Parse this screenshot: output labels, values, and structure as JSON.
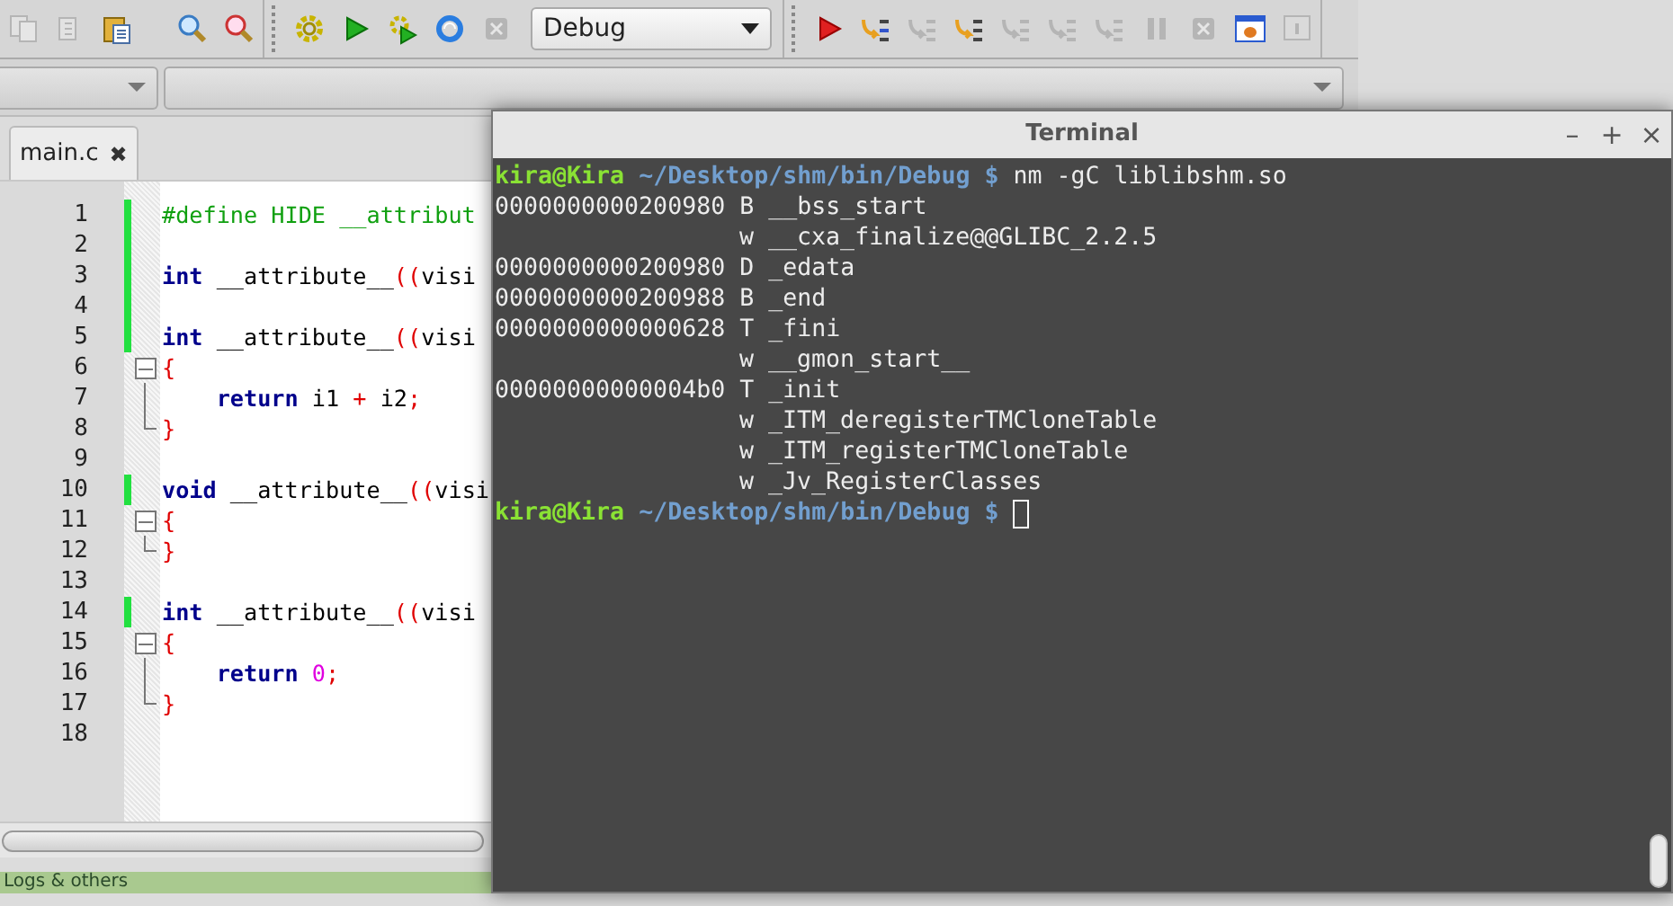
{
  "toolbar": {
    "groups": [
      {
        "buttons": [
          {
            "kind": "copy",
            "disabled": true
          },
          {
            "kind": "paste",
            "disabled": true
          },
          {
            "kind": "clipboard",
            "disabled": false
          },
          {
            "kind": "find",
            "disabled": false
          },
          {
            "kind": "replace",
            "disabled": false
          }
        ]
      },
      {
        "buttons": [
          {
            "kind": "build",
            "disabled": false
          },
          {
            "kind": "run",
            "disabled": false
          },
          {
            "kind": "build-run",
            "disabled": false
          },
          {
            "kind": "rebuild",
            "disabled": false
          },
          {
            "kind": "abort",
            "disabled": true
          }
        ],
        "target": {
          "value": "Debug"
        }
      },
      {
        "buttons": [
          {
            "kind": "debug",
            "disabled": false
          },
          {
            "kind": "step-into",
            "disabled": false
          },
          {
            "kind": "step-out",
            "disabled": true
          },
          {
            "kind": "next-line",
            "disabled": false
          },
          {
            "kind": "step-back",
            "disabled": true
          },
          {
            "kind": "next-instruction",
            "disabled": true
          },
          {
            "kind": "step-instruction",
            "disabled": true
          },
          {
            "kind": "pause",
            "disabled": true
          },
          {
            "kind": "stop",
            "disabled": true
          },
          {
            "kind": "debug-window",
            "disabled": false
          },
          {
            "kind": "info",
            "disabled": true
          }
        ]
      }
    ]
  },
  "tabs": [
    {
      "label": "main.c",
      "close": "✖",
      "selected": true
    }
  ],
  "editor": {
    "lines": [
      {
        "number": "1",
        "changed": true,
        "fold_start": false,
        "fold_end": false,
        "tokens": [
          {
            "kind": "preprocessor",
            "text": "#define HIDE __attribut"
          }
        ]
      },
      {
        "number": "2",
        "changed": true,
        "fold_start": false,
        "fold_end": false
      },
      {
        "number": "3",
        "changed": true,
        "fold_start": false,
        "fold_end": false,
        "tokens": [
          {
            "kind": "keyword",
            "text": "int"
          },
          {
            "kind": "plain",
            "text": " __attribute__"
          },
          {
            "kind": "punct",
            "text": "(("
          },
          {
            "kind": "plain",
            "text": "visi"
          }
        ]
      },
      {
        "number": "4",
        "changed": true,
        "fold_start": false,
        "fold_end": false
      },
      {
        "number": "5",
        "changed": true,
        "fold_start": false,
        "fold_end": false,
        "tokens": [
          {
            "kind": "keyword",
            "text": "int"
          },
          {
            "kind": "plain",
            "text": " __attribute__"
          },
          {
            "kind": "punct",
            "text": "(("
          },
          {
            "kind": "plain",
            "text": "visi"
          }
        ]
      },
      {
        "number": "6",
        "changed": false,
        "fold_start": true,
        "fold_end": false,
        "tokens": [
          {
            "kind": "punct",
            "text": "{"
          }
        ]
      },
      {
        "number": "7",
        "changed": false,
        "fold_start": false,
        "fold_end": false,
        "tokens": [
          {
            "kind": "keyword",
            "text": "    return"
          },
          {
            "kind": "plain",
            "text": " i1 "
          },
          {
            "kind": "punct",
            "text": "+"
          },
          {
            "kind": "plain",
            "text": " i2"
          },
          {
            "kind": "punct",
            "text": ";"
          }
        ]
      },
      {
        "number": "8",
        "changed": false,
        "fold_start": false,
        "fold_end": true,
        "tokens": [
          {
            "kind": "punct",
            "text": "}"
          }
        ]
      },
      {
        "number": "9",
        "changed": false,
        "fold_start": false,
        "fold_end": false
      },
      {
        "number": "10",
        "changed": true,
        "fold_start": false,
        "fold_end": false,
        "tokens": [
          {
            "kind": "keyword",
            "text": "void"
          },
          {
            "kind": "plain",
            "text": " __attribute__"
          },
          {
            "kind": "punct",
            "text": "(("
          },
          {
            "kind": "plain",
            "text": "visi"
          }
        ]
      },
      {
        "number": "11",
        "changed": false,
        "fold_start": true,
        "fold_end": false,
        "tokens": [
          {
            "kind": "punct",
            "text": "{"
          }
        ]
      },
      {
        "number": "12",
        "changed": false,
        "fold_start": false,
        "fold_end": true,
        "tokens": [
          {
            "kind": "punct",
            "text": "}"
          }
        ]
      },
      {
        "number": "13",
        "changed": false,
        "fold_start": false,
        "fold_end": false
      },
      {
        "number": "14",
        "changed": true,
        "fold_start": false,
        "fold_end": false,
        "tokens": [
          {
            "kind": "keyword",
            "text": "int"
          },
          {
            "kind": "plain",
            "text": " __attribute__"
          },
          {
            "kind": "punct",
            "text": "(("
          },
          {
            "kind": "plain",
            "text": "visi"
          }
        ]
      },
      {
        "number": "15",
        "changed": false,
        "fold_start": true,
        "fold_end": false,
        "tokens": [
          {
            "kind": "punct",
            "text": "{"
          }
        ]
      },
      {
        "number": "16",
        "changed": false,
        "fold_start": false,
        "fold_end": false,
        "tokens": [
          {
            "kind": "keyword",
            "text": "    return"
          },
          {
            "kind": "number",
            "text": " 0"
          },
          {
            "kind": "punct",
            "text": ";"
          }
        ]
      },
      {
        "number": "17",
        "changed": false,
        "fold_start": false,
        "fold_end": true,
        "tokens": [
          {
            "kind": "punct",
            "text": "}"
          }
        ]
      },
      {
        "number": "18",
        "changed": false,
        "fold_start": false,
        "fold_end": false
      }
    ]
  },
  "bottom_panel": {
    "label": "Logs & others"
  },
  "terminal": {
    "title": "Terminal",
    "controls": [
      "–",
      "+",
      "×"
    ],
    "lines": [
      {
        "kind": "prompt",
        "user": "kira@Kira",
        "path": "~/Desktop/shm/bin/Debug $",
        "command": "nm -gC liblibshm.so",
        "cursor": false
      },
      {
        "kind": "output",
        "address": "0000000000200980",
        "type": "B",
        "symbol": "__bss_start"
      },
      {
        "kind": "output",
        "type": "w",
        "symbol": "__cxa_finalize@@GLIBC_2.2.5"
      },
      {
        "kind": "output",
        "address": "0000000000200980",
        "type": "D",
        "symbol": "_edata"
      },
      {
        "kind": "output",
        "address": "0000000000200988",
        "type": "B",
        "symbol": "_end"
      },
      {
        "kind": "output",
        "address": "0000000000000628",
        "type": "T",
        "symbol": "_fini"
      },
      {
        "kind": "output",
        "type": "w",
        "symbol": "__gmon_start__"
      },
      {
        "kind": "output",
        "address": "00000000000004b0",
        "type": "T",
        "symbol": "_init"
      },
      {
        "kind": "output",
        "type": "w",
        "symbol": "_ITM_deregisterTMCloneTable"
      },
      {
        "kind": "output",
        "type": "w",
        "symbol": "_ITM_registerTMCloneTable"
      },
      {
        "kind": "output",
        "type": "w",
        "symbol": "_Jv_RegisterClasses"
      },
      {
        "kind": "prompt",
        "user": "kira@Kira",
        "path": "~/Desktop/shm/bin/Debug $",
        "cursor": true
      }
    ]
  }
}
